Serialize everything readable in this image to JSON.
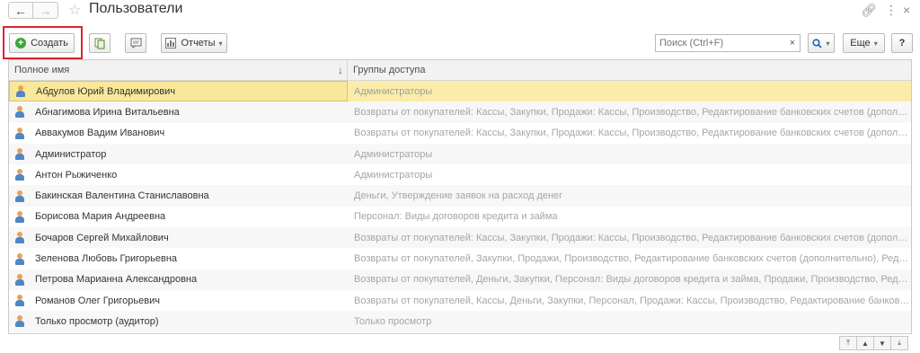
{
  "window": {
    "title": "Пользователи",
    "back_icon": "arrow-left-icon",
    "forward_icon": "arrow-right-icon",
    "favorite_icon": "star-icon",
    "link_icon": "link-icon",
    "menu_icon": "vertical-ellipsis-icon",
    "close_icon": "close-icon"
  },
  "toolbar": {
    "create_label": "Создать",
    "reports_label": "Отчеты",
    "search_placeholder": "Поиск (Ctrl+F)",
    "clear_label": "×",
    "more_label": "Еще",
    "help_label": "?",
    "highlight_color": "#d9262e"
  },
  "table": {
    "columns": [
      "Полное имя",
      "Группы доступа"
    ],
    "rows": [
      {
        "name": "Абдулов Юрий Владимирович",
        "groups": "Администраторы",
        "selected": true
      },
      {
        "name": "Абнагимова Ирина Витальевна",
        "groups": "Возвраты от покупателей: Кассы, Закупки, Продажи: Кассы, Производство, Редактирование банковских счетов (дополнительно)"
      },
      {
        "name": "Аввакумов Вадим Иванович",
        "groups": "Возвраты от покупателей: Кассы, Закупки, Продажи: Кассы, Производство, Редактирование банковских счетов (дополнительно)"
      },
      {
        "name": "Администратор",
        "groups": "Администраторы"
      },
      {
        "name": "Антон Рыжиченко",
        "groups": "Администраторы"
      },
      {
        "name": "Бакинская Валентина Станиславовна",
        "groups": "Деньги, Утверждение заявок на расход денег"
      },
      {
        "name": "Борисова Мария Андреевна",
        "groups": "Персонал: Виды договоров кредита и займа"
      },
      {
        "name": "Бочаров Сергей Михайлович",
        "groups": "Возвраты от покупателей: Кассы, Закупки, Продажи: Кассы, Производство, Редактирование банковских счетов (дополнительно)"
      },
      {
        "name": "Зеленова Любовь Григорьевна",
        "groups": "Возвраты от покупателей, Закупки, Продажи, Производство, Редактирование банковских счетов (дополнительно), Редактирование"
      },
      {
        "name": "Петрова Марианна Александровна",
        "groups": "Возвраты от покупателей, Деньги, Закупки, Персонал: Виды договоров кредита и займа, Продажи, Производство, Редактирование"
      },
      {
        "name": "Романов Олег Григорьевич",
        "groups": "Возвраты от покупателей, Кассы, Деньги, Закупки, Персонал, Продажи: Кассы, Производство, Редактирование банковских счетов"
      },
      {
        "name": "Только просмотр (аудитор)",
        "groups": "Только просмотр"
      }
    ]
  },
  "colors": {
    "selected_row": "#fbeda9",
    "create_icon": "#39a639"
  }
}
